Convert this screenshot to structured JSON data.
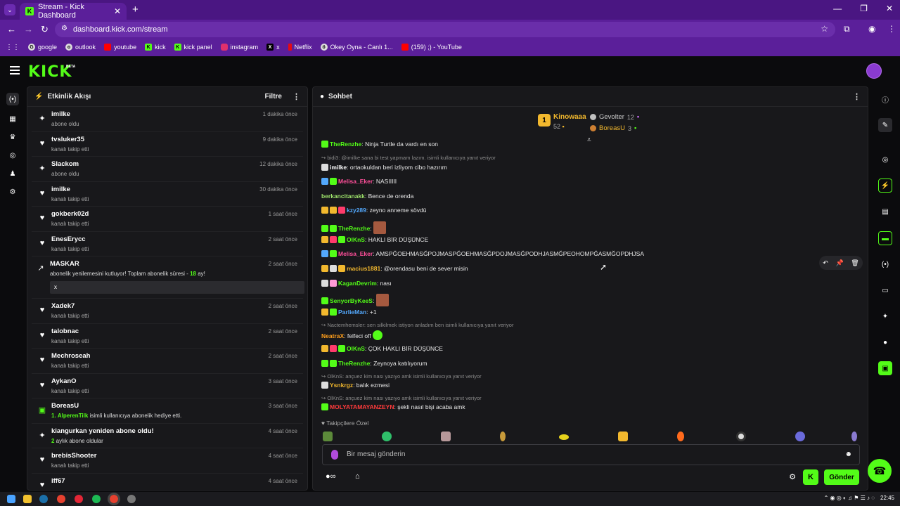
{
  "browser": {
    "tab_title": "Stream - Kick Dashboard",
    "tab_favicon": "K",
    "url": "dashboard.kick.com/stream",
    "bookmarks": [
      "google",
      "outlook",
      "youtube",
      "kick",
      "kick panel",
      "instagram",
      "x",
      "Netflix",
      "Okey Oyna - Canlı 1...",
      "(159) ;) - YouTube"
    ]
  },
  "header": {
    "logo": "KICK",
    "beta": "BETA"
  },
  "activity": {
    "title": "Etkinlik Akışı",
    "filter_label": "Filtre",
    "items": [
      {
        "icon": "sparkle",
        "name": "imilke",
        "sub": "abone oldu",
        "time": "1 dakika önce"
      },
      {
        "icon": "heart",
        "name": "tvsluker35",
        "sub": "kanalı takip etti",
        "time": "9 dakika önce"
      },
      {
        "icon": "sparkle",
        "name": "Slackom",
        "sub": "abone oldu",
        "time": "12 dakika önce"
      },
      {
        "icon": "heart",
        "name": "imilke",
        "sub": "kanalı takip etti",
        "time": "30 dakika önce"
      },
      {
        "icon": "heart",
        "name": "gokberk02d",
        "sub": "kanalı takip etti",
        "time": "1 saat önce"
      },
      {
        "icon": "heart",
        "name": "EnesErycc",
        "sub": "kanalı takip etti",
        "time": "2 saat önce"
      }
    ],
    "renew": {
      "name": "MASKAR",
      "time": "2 saat önce",
      "text_before": "abonelik yenilemesini kutluyor! Toplam abonelik süresi - ",
      "months": "18",
      "text_after": " ay!",
      "message": "x"
    },
    "items2": [
      {
        "icon": "heart",
        "name": "Xadek7",
        "sub": "kanalı takip etti",
        "time": "2 saat önce"
      },
      {
        "icon": "heart",
        "name": "talobnac",
        "sub": "kanalı takip etti",
        "time": "2 saat önce"
      },
      {
        "icon": "heart",
        "name": "Mechroseah",
        "sub": "kanalı takip etti",
        "time": "2 saat önce"
      },
      {
        "icon": "heart",
        "name": "AykanO",
        "sub": "kanalı takip etti",
        "time": "3 saat önce"
      }
    ],
    "gift": {
      "name": "BoreasU",
      "count": "1.",
      "gifted_to": "AlperenTilk",
      "text": " isimli kullanıcıya abonelik hediye etti.",
      "time": "3 saat önce"
    },
    "resub": {
      "name": "kiangurkan yeniden abone oldu!",
      "months": "2",
      "text": " aylık abone oldular",
      "time": "4 saat önce"
    },
    "items3": [
      {
        "icon": "heart",
        "name": "brebisShooter",
        "sub": "kanalı takip etti",
        "time": "4 saat önce"
      },
      {
        "icon": "heart",
        "name": "iff67",
        "sub": "",
        "time": "4 saat önce"
      }
    ]
  },
  "chat": {
    "title": "Sohbet",
    "leader1": {
      "rank": "1",
      "name": "Kinowaaa",
      "count": "52"
    },
    "leader2": {
      "name": "Gevolter",
      "count": "12"
    },
    "leader3": {
      "name": "BoreasU",
      "count": "3"
    },
    "messages": [
      {
        "type": "msg",
        "user": "TheRenzhe",
        "color": "#53fc18",
        "text": ": Ninja Turtle da vardı en son"
      },
      {
        "type": "reply",
        "text": "↪ bidi3: @imilke sana bi test yapmam lazım. isimli kullanıcıya yanıt veriyor"
      },
      {
        "type": "msg",
        "user": "imilke",
        "color": "#ffffff",
        "text": ": ortaokuldan beri izliyom cibo hazırım"
      },
      {
        "type": "msg",
        "user": "Melisa_Eker",
        "color": "#ff4f9a",
        "text": ": NASIIIII"
      },
      {
        "type": "msg",
        "user": "berkancitanakk",
        "color": "#9ee36b",
        "text": ": Bence de orenda"
      },
      {
        "type": "msg",
        "user": "kzy289",
        "color": "#53a8fc",
        "text": ": zeyno anneme sövdü"
      },
      {
        "type": "msg",
        "user": "TheRenzhe",
        "color": "#53fc18",
        "text": ": "
      },
      {
        "type": "msg",
        "user": "OlKnS",
        "color": "#53fc18",
        "text": ": HAKLI BİR DÜŞÜNCE"
      },
      {
        "type": "msg",
        "user": "Melisa_Eker",
        "color": "#ff4f9a",
        "text": ": AMSPĞOEHMASĞPOJMASPĞOEHMASĞPDOJMASĞPODHJASMĞPEOHOMPĞASMĞOPDHJSA"
      },
      {
        "type": "msg",
        "user": "macius1881",
        "color": "#f2b82e",
        "text": ": @orendasu beni de sever misin"
      },
      {
        "type": "msg",
        "user": "KaganDevrim",
        "color": "#53fc18",
        "text": ": nası"
      },
      {
        "type": "msg",
        "user": "SenyorByKeeS",
        "color": "#53fc18",
        "text": ": "
      },
      {
        "type": "msg",
        "user": "ParlieMan",
        "color": "#53a8fc",
        "text": ": +1"
      },
      {
        "type": "reply",
        "text": "↪ Nactemhemsler: sen silkilmek istiyon anladım ben  isimli kullanıcıya yanıt veriyor"
      },
      {
        "type": "msg",
        "user": "NeatraX",
        "color": "#ff9f1c",
        "text": ": felfeci off"
      },
      {
        "type": "msg",
        "user": "OlKnS",
        "color": "#53fc18",
        "text": ": ÇOK HAKLI BİR DÜŞÜNCE"
      },
      {
        "type": "msg",
        "user": "TheRenzhe",
        "color": "#53fc18",
        "text": ": Zeynoya katılıyorum"
      },
      {
        "type": "reply",
        "text": "↪ OlKnS: ançuez kim nası yazıyo amk isimli kullanıcıya yanıt veriyor"
      },
      {
        "type": "msg",
        "user": "Ysnkrgz",
        "color": "#f2b82e",
        "text": ": balık ezmesi"
      },
      {
        "type": "reply",
        "text": "↪ OlKnS: ançuez kim nası yazıyo amk isimli kullanıcıya yanıt veriyor"
      },
      {
        "type": "msg",
        "user": "MOLYATAMAYANZEYN",
        "color": "#ff3b3b",
        "text": ": şekli nasıl bişi acaba amk"
      }
    ],
    "follower_label": "Takipçilere Özel",
    "input_placeholder": "Bir mesaj gönderin",
    "send_label": "Gönder"
  },
  "taskbar": {
    "time": "22:45"
  }
}
